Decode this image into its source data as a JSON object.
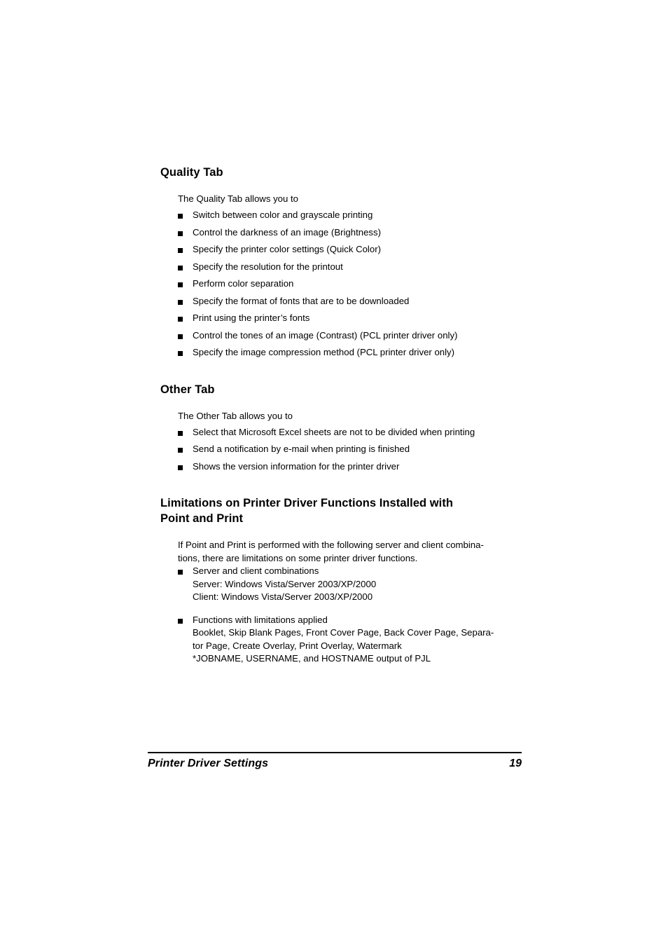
{
  "document": {
    "sections": [
      {
        "heading": "Quality Tab",
        "lead": "The Quality Tab allows you to",
        "bullets": [
          "Switch between color and grayscale printing",
          "Control the darkness of an image (Brightness)",
          "Specify the printer color settings (Quick Color)",
          "Specify the resolution for the printout",
          "Perform color separation",
          "Specify the format of fonts that are to be downloaded",
          "Print using the printer’s fonts",
          "Control the tones of an image (Contrast) (PCL printer driver only)",
          "Specify the image compression method (PCL printer driver only)"
        ]
      },
      {
        "heading": "Other Tab",
        "lead": "The Other Tab allows you to",
        "bullets": [
          "Select that Microsoft Excel sheets are not to be divided when printing",
          "Send a notification by e-mail when printing is finished",
          "Shows the version information for the printer driver"
        ]
      }
    ],
    "limitations": {
      "heading_line1": "Limitations on Printer Driver Functions Installed with",
      "heading_line2": "Point and Print",
      "paragraph_line1": "If Point and Print is performed with the following server and client combina-",
      "paragraph_line2": "tions, there are limitations on some printer driver functions.",
      "items": [
        {
          "title": "Server and client combinations",
          "lines": [
            "Server: Windows Vista/Server 2003/XP/2000",
            "Client: Windows Vista/Server 2003/XP/2000"
          ]
        },
        {
          "title": "Functions with limitations applied",
          "lines": [
            "Booklet, Skip Blank Pages, Front Cover Page, Back Cover Page, Separa-",
            "tor Page, Create Overlay, Print Overlay, Watermark",
            "*JOBNAME, USERNAME, and HOSTNAME output of PJL"
          ]
        }
      ]
    }
  },
  "footer": {
    "title": "Printer Driver Settings",
    "page_number": "19"
  }
}
